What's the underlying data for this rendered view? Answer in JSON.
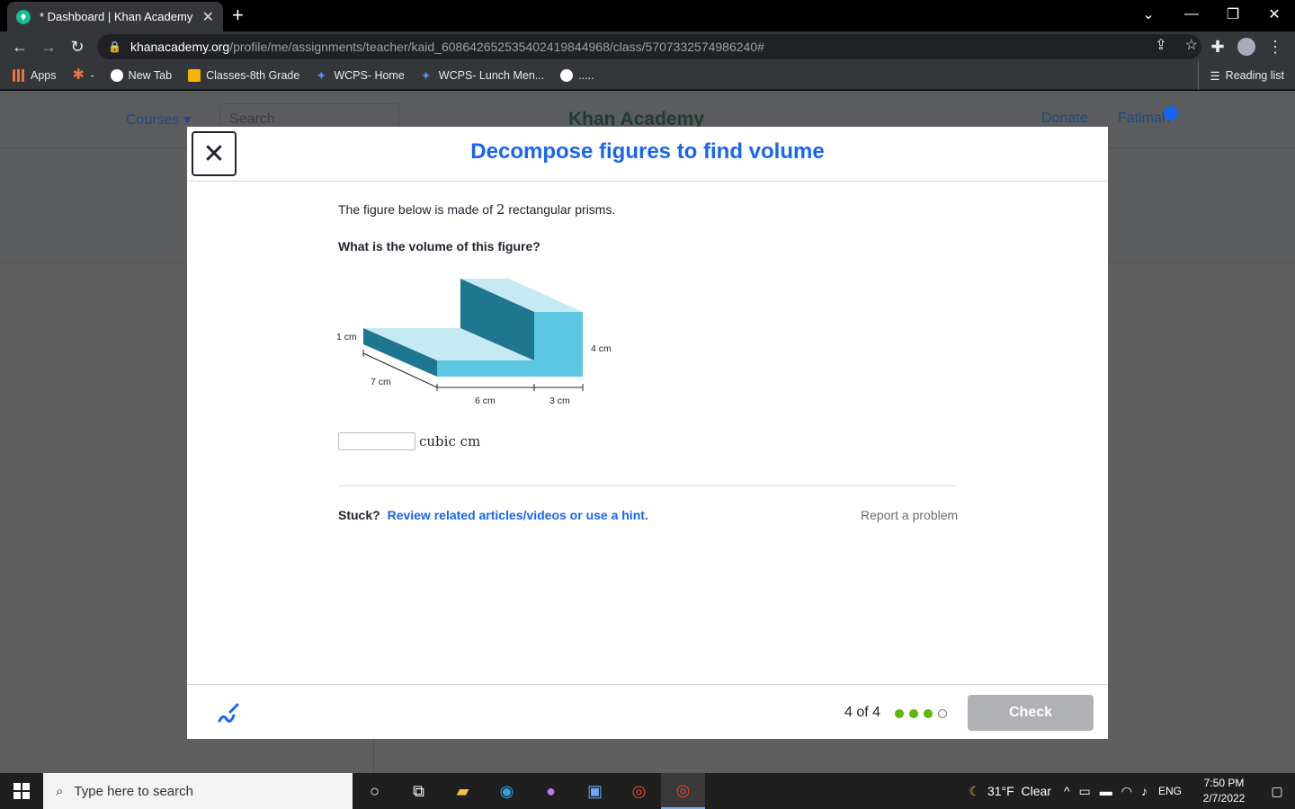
{
  "browser": {
    "tab_title": "* Dashboard | Khan Academy",
    "url_host": "khanacademy.org",
    "url_path": "/profile/me/assignments/teacher/kaid_608642652535402419844968/class/5707332574986240#",
    "bookmarks": [
      {
        "label": "Apps"
      },
      {
        "label": "-"
      },
      {
        "label": "New Tab"
      },
      {
        "label": "Classes-8th Grade"
      },
      {
        "label": "WCPS- Home"
      },
      {
        "label": "WCPS- Lunch Men..."
      },
      {
        "label": "....."
      }
    ],
    "reading_list": "Reading list"
  },
  "ka_header": {
    "courses": "Courses",
    "search_placeholder": "Search",
    "brand": "Khan Academy",
    "donate": "Donate",
    "user": "Fatimah"
  },
  "modal": {
    "title": "Decompose figures to find volume",
    "question_prefix": "The figure below is made of",
    "question_number": "2",
    "question_suffix": "rectangular prisms.",
    "question_ask": "What is the volume of this figure?",
    "figure_labels": {
      "height_small": "1 cm",
      "depth": "7 cm",
      "width_left": "6 cm",
      "width_right": "3 cm",
      "height_tall": "4 cm"
    },
    "answer_value": "",
    "answer_unit": "cubic cm",
    "stuck_label": "Stuck?",
    "hint_link": "Review related articles/videos or use a hint.",
    "report": "Report a problem",
    "progress": "4 of 4",
    "check": "Check"
  },
  "colors": {
    "prism_top": "#c6eaf4",
    "prism_front": "#5bc7e1",
    "prism_dark": "#1f768f",
    "dot_done": "#5cb800",
    "accent": "#1865f2"
  },
  "taskbar": {
    "search_placeholder": "Type here to search",
    "weather": "31°F  Clear",
    "lang": "ENG",
    "time": "7:50 PM",
    "date": "2/7/2022"
  }
}
